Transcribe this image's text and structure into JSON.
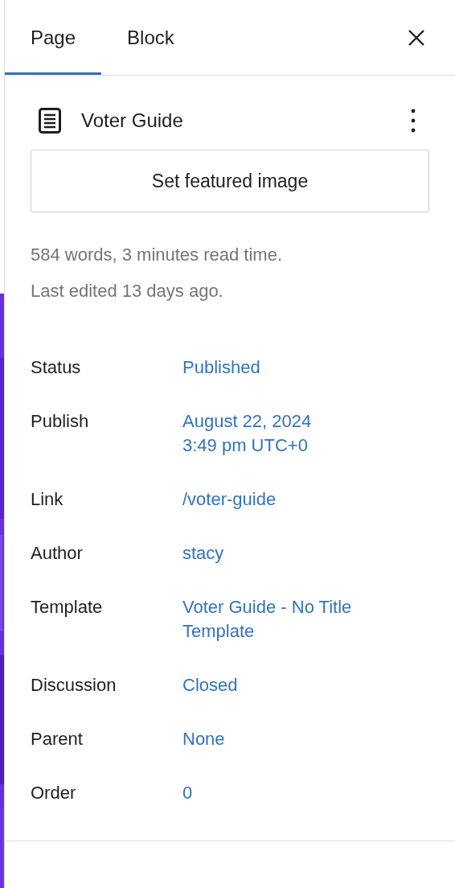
{
  "tabs": [
    {
      "label": "Page",
      "selected": true
    },
    {
      "label": "Block",
      "selected": false
    }
  ],
  "document": {
    "title": "Voter Guide"
  },
  "featured_image_button": "Set featured image",
  "stats": [
    "584 words, 3 minutes read time.",
    "Last edited 13 days ago."
  ],
  "settings": [
    {
      "label": "Status",
      "value": [
        "Published"
      ]
    },
    {
      "label": "Publish",
      "value": [
        "August 22, 2024",
        "3:49 pm UTC+0"
      ]
    },
    {
      "label": "Link",
      "value": [
        "/voter-guide"
      ]
    },
    {
      "label": "Author",
      "value": [
        "stacy"
      ]
    },
    {
      "label": "Template",
      "value": [
        "Voter Guide - No Title Template"
      ]
    },
    {
      "label": "Discussion",
      "value": [
        "Closed"
      ]
    },
    {
      "label": "Parent",
      "value": [
        "None"
      ]
    },
    {
      "label": "Order",
      "value": [
        "0"
      ]
    }
  ]
}
